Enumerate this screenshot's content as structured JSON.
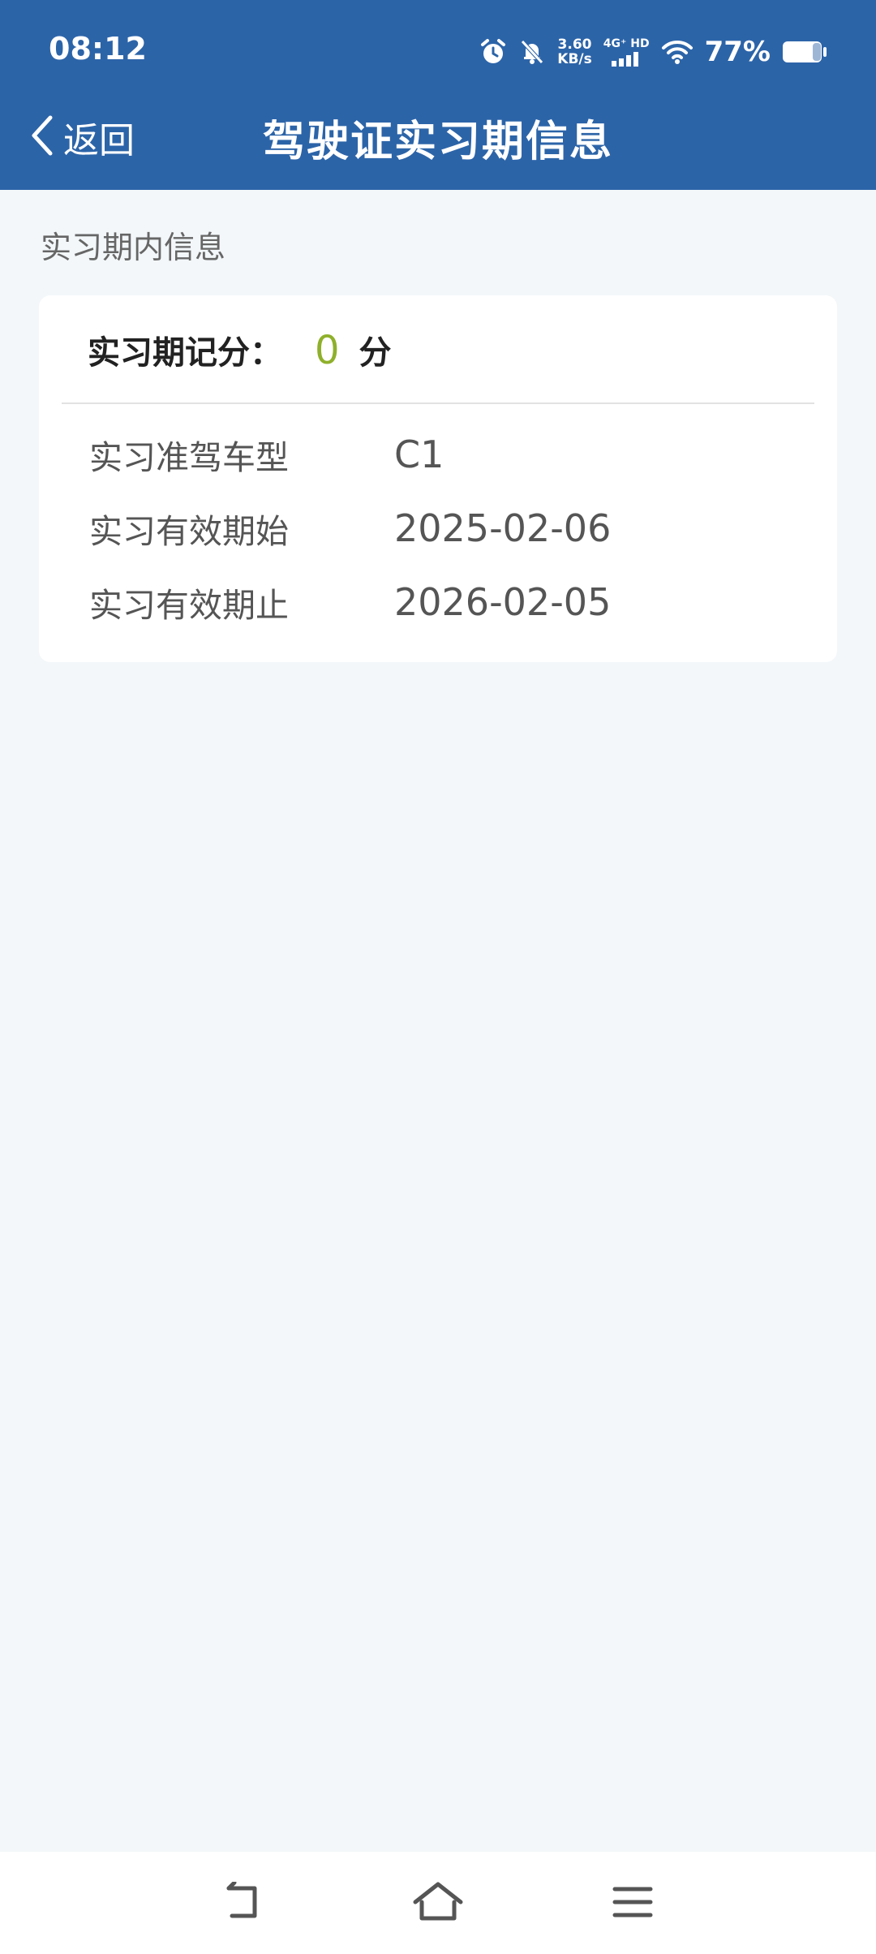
{
  "status_bar": {
    "time": "08:12",
    "speed_value": "3.60",
    "speed_unit": "KB/s",
    "network": "4G⁺ HD",
    "battery_percent": "77%"
  },
  "header": {
    "back_label": "返回",
    "title": "驾驶证实习期信息",
    "background_color": "#2c64a8"
  },
  "section": {
    "label": "实习期内信息"
  },
  "card": {
    "score_label": "实习期记分：",
    "score_value": "0",
    "score_unit": "分",
    "score_color": "#8fb02b",
    "rows": [
      {
        "label": "实习准驾车型",
        "value": "C1"
      },
      {
        "label": "实习有效期始",
        "value": "2025-02-06"
      },
      {
        "label": "实习有效期止",
        "value": "2026-02-05"
      }
    ]
  },
  "system_nav": {
    "icons": [
      "back-icon",
      "home-icon",
      "menu-icon"
    ]
  }
}
